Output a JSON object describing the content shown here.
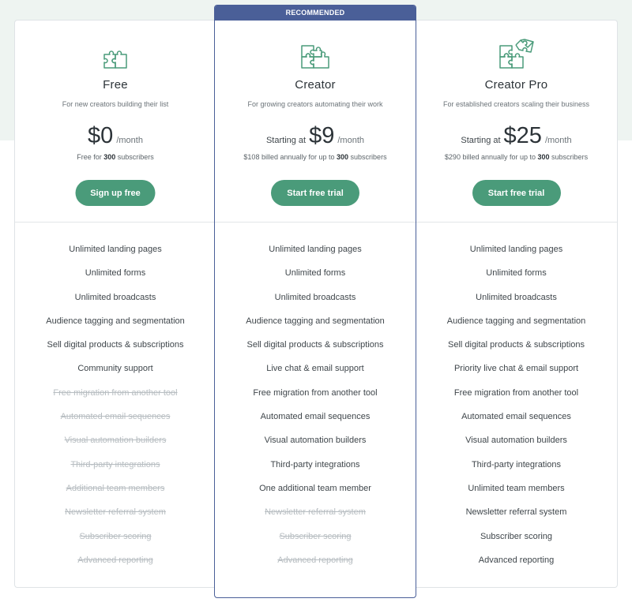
{
  "colors": {
    "accent_green": "#4a9b7a",
    "recommended_blue": "#4a5f98",
    "band_background": "#eef4f1"
  },
  "plans": [
    {
      "id": "free",
      "icon": "puzzle-two-pieces-icon",
      "name": "Free",
      "description": "For new creators building their list",
      "price_prefix": "",
      "price": "$0",
      "period": "/month",
      "note_before": "Free for ",
      "note_bold": "300",
      "note_after": " subscribers",
      "cta": "Sign up free",
      "recommended": false,
      "features": [
        {
          "label": "Unlimited landing pages",
          "included": true
        },
        {
          "label": "Unlimited forms",
          "included": true
        },
        {
          "label": "Unlimited broadcasts",
          "included": true
        },
        {
          "label": "Audience tagging and segmentation",
          "included": true
        },
        {
          "label": "Sell digital products & subscriptions",
          "included": true
        },
        {
          "label": "Community support",
          "included": true
        },
        {
          "label": "Free migration from another tool",
          "included": false
        },
        {
          "label": "Automated email sequences",
          "included": false
        },
        {
          "label": "Visual automation builders",
          "included": false
        },
        {
          "label": "Third-party integrations",
          "included": false
        },
        {
          "label": "Additional team members",
          "included": false
        },
        {
          "label": "Newsletter referral system",
          "included": false
        },
        {
          "label": "Subscriber scoring",
          "included": false
        },
        {
          "label": "Advanced reporting",
          "included": false
        }
      ]
    },
    {
      "id": "creator",
      "icon": "puzzle-four-pieces-icon",
      "name": "Creator",
      "description": "For growing creators automating their work",
      "price_prefix": "Starting at",
      "price": "$9",
      "period": "/month",
      "note_before": "$108 billed annually for up to ",
      "note_bold": "300",
      "note_after": " subscribers",
      "cta": "Start free trial",
      "recommended": true,
      "badge": "RECOMMENDED",
      "features": [
        {
          "label": "Unlimited landing pages",
          "included": true
        },
        {
          "label": "Unlimited forms",
          "included": true
        },
        {
          "label": "Unlimited broadcasts",
          "included": true
        },
        {
          "label": "Audience tagging and segmentation",
          "included": true
        },
        {
          "label": "Sell digital products & subscriptions",
          "included": true
        },
        {
          "label": "Live chat & email support",
          "included": true
        },
        {
          "label": "Free migration from another tool",
          "included": true
        },
        {
          "label": "Automated email sequences",
          "included": true
        },
        {
          "label": "Visual automation builders",
          "included": true
        },
        {
          "label": "Third-party integrations",
          "included": true
        },
        {
          "label": "One additional team member",
          "included": true
        },
        {
          "label": "Newsletter referral system",
          "included": false
        },
        {
          "label": "Subscriber scoring",
          "included": false
        },
        {
          "label": "Advanced reporting",
          "included": false
        }
      ]
    },
    {
      "id": "pro",
      "icon": "puzzle-five-pieces-icon",
      "name": "Creator Pro",
      "description": "For established creators scaling their business",
      "price_prefix": "Starting at",
      "price": "$25",
      "period": "/month",
      "note_before": "$290 billed annually for up to ",
      "note_bold": "300",
      "note_after": " subscribers",
      "cta": "Start free trial",
      "recommended": false,
      "features": [
        {
          "label": "Unlimited landing pages",
          "included": true
        },
        {
          "label": "Unlimited forms",
          "included": true
        },
        {
          "label": "Unlimited broadcasts",
          "included": true
        },
        {
          "label": "Audience tagging and segmentation",
          "included": true
        },
        {
          "label": "Sell digital products & subscriptions",
          "included": true
        },
        {
          "label": "Priority live chat & email support",
          "included": true
        },
        {
          "label": "Free migration from another tool",
          "included": true
        },
        {
          "label": "Automated email sequences",
          "included": true
        },
        {
          "label": "Visual automation builders",
          "included": true
        },
        {
          "label": "Third-party integrations",
          "included": true
        },
        {
          "label": "Unlimited team members",
          "included": true
        },
        {
          "label": "Newsletter referral system",
          "included": true
        },
        {
          "label": "Subscriber scoring",
          "included": true
        },
        {
          "label": "Advanced reporting",
          "included": true
        }
      ]
    }
  ]
}
